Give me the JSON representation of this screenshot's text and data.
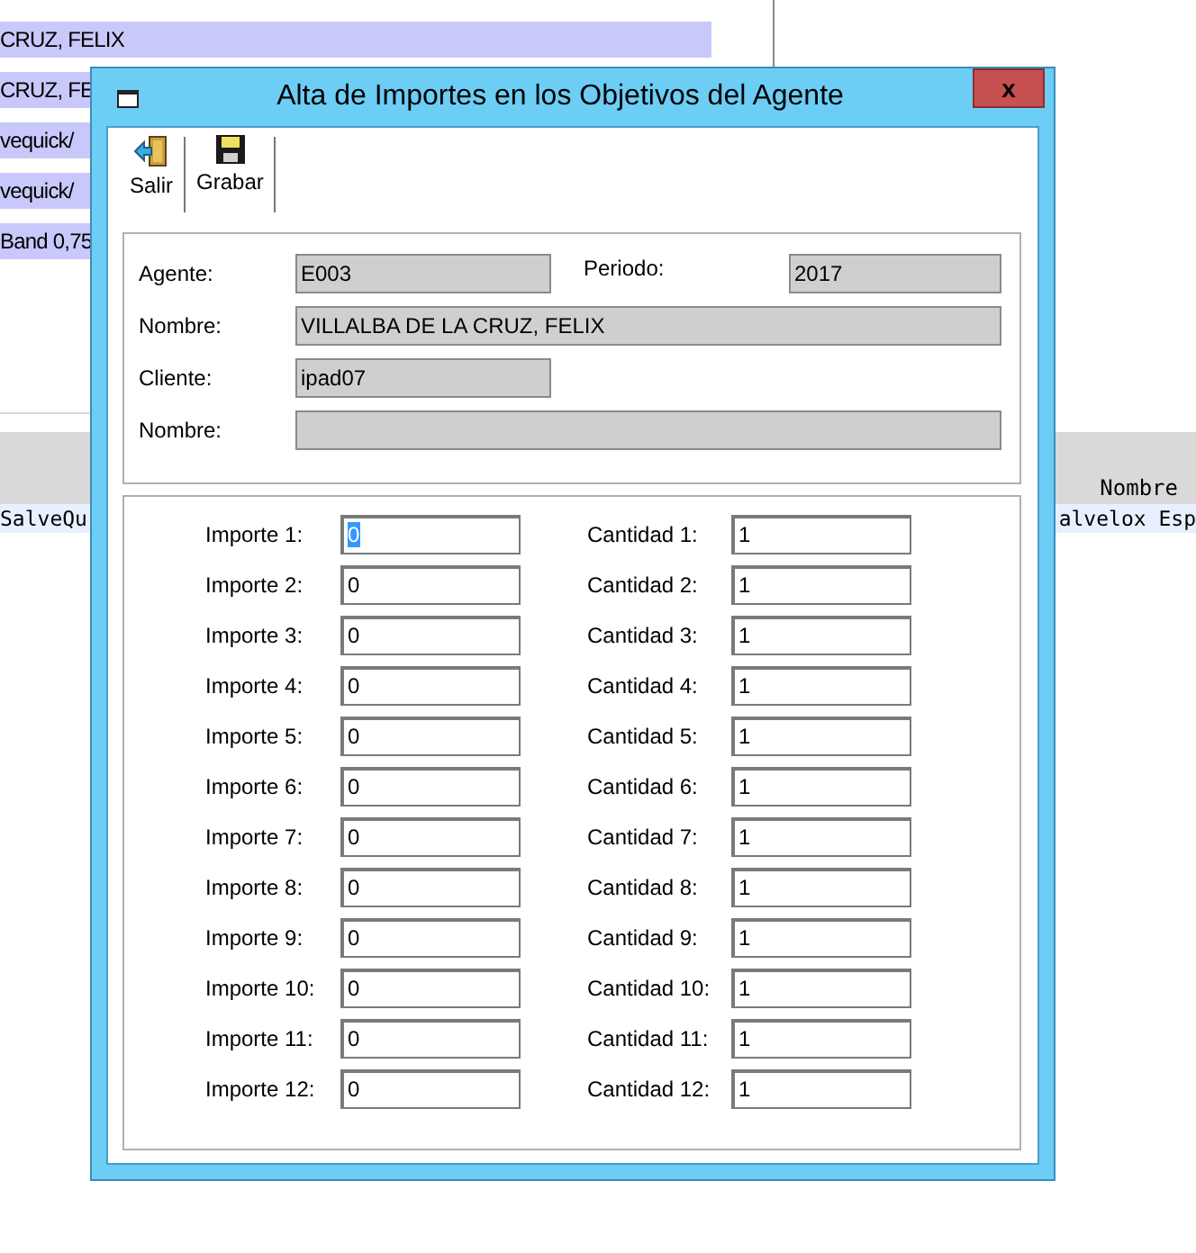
{
  "background": {
    "rows": [
      {
        "text": "CRUZ, FELIX"
      },
      {
        "text": "CRUZ, FE"
      },
      {
        "text": "vequick/"
      },
      {
        "text": "vequick/"
      },
      {
        "text": "Band 0,75"
      }
    ],
    "grid": {
      "header": "Nombre",
      "left_cell": "SalveQu",
      "right_cell": "alvelox Esp"
    }
  },
  "dialog": {
    "title": "Alta de Importes en los Objetivos del Agente",
    "close": "x",
    "toolbar": [
      {
        "kind": "exit",
        "label": "Salir"
      },
      {
        "kind": "save",
        "label": "Grabar"
      }
    ],
    "header_fields": {
      "agente_label": "Agente:",
      "agente": "E003",
      "periodo_label": "Periodo:",
      "periodo": "2017",
      "nombre_label": "Nombre:",
      "nombre": "VILLALBA DE LA CRUZ, FELIX",
      "cliente_label": "Cliente:",
      "cliente": "ipad07",
      "cliente_nombre_label": "Nombre:"
    },
    "importes": [
      {
        "label": "Importe 1:",
        "value": "0",
        "selected": true
      },
      {
        "label": "Importe 2:",
        "value": "0",
        "selected": false
      },
      {
        "label": "Importe 3:",
        "value": "0",
        "selected": false
      },
      {
        "label": "Importe 4:",
        "value": "0",
        "selected": false
      },
      {
        "label": "Importe 5:",
        "value": "0",
        "selected": false
      },
      {
        "label": "Importe 6:",
        "value": "0",
        "selected": false
      },
      {
        "label": "Importe 7:",
        "value": "0",
        "selected": false
      },
      {
        "label": "Importe 8:",
        "value": "0",
        "selected": false
      },
      {
        "label": "Importe 9:",
        "value": "0",
        "selected": false
      },
      {
        "label": "Importe 10:",
        "value": "0",
        "selected": false
      },
      {
        "label": "Importe 11:",
        "value": "0",
        "selected": false
      },
      {
        "label": "Importe 12:",
        "value": "0",
        "selected": false
      }
    ],
    "cantidades": [
      {
        "label": "Cantidad 1:",
        "value": "1"
      },
      {
        "label": "Cantidad 2:",
        "value": "1"
      },
      {
        "label": "Cantidad 3:",
        "value": "1"
      },
      {
        "label": "Cantidad 4:",
        "value": "1"
      },
      {
        "label": "Cantidad 5:",
        "value": "1"
      },
      {
        "label": "Cantidad 6:",
        "value": "1"
      },
      {
        "label": "Cantidad 7:",
        "value": "1"
      },
      {
        "label": "Cantidad 8:",
        "value": "1"
      },
      {
        "label": "Cantidad 9:",
        "value": "1"
      },
      {
        "label": "Cantidad 10:",
        "value": "1"
      },
      {
        "label": "Cantidad 11:",
        "value": "1"
      },
      {
        "label": "Cantidad 12:",
        "value": "1"
      }
    ]
  }
}
